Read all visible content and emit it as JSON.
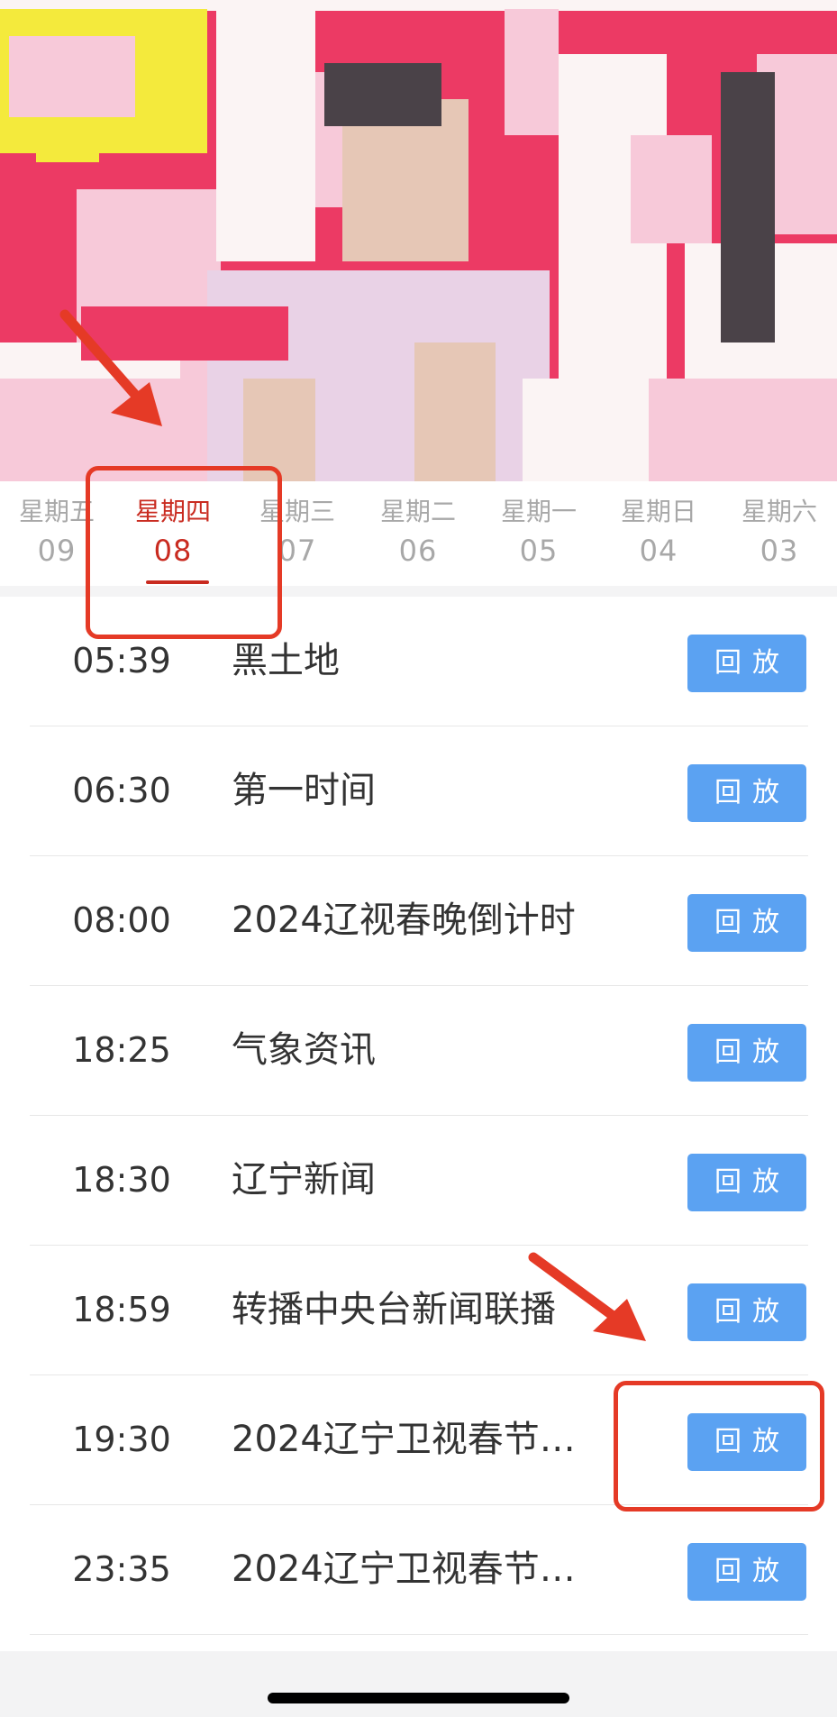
{
  "poster": {
    "colors": {
      "background": "#ec3a64",
      "pink_light": "#f7c9d9",
      "white": "#fbf4f4",
      "yellow": "#f4ea3c",
      "skin": "#e6c7b6",
      "dress": "#e9d2e6",
      "dark_hair": "#4a4248"
    }
  },
  "day_tabs": [
    {
      "weekday": "星期五",
      "day": "09"
    },
    {
      "weekday": "星期四",
      "day": "08"
    },
    {
      "weekday": "星期三",
      "day": "07"
    },
    {
      "weekday": "星期二",
      "day": "06"
    },
    {
      "weekday": "星期一",
      "day": "05"
    },
    {
      "weekday": "星期日",
      "day": "04"
    },
    {
      "weekday": "星期六",
      "day": "03"
    }
  ],
  "selected_tab": "星期四",
  "programs": [
    {
      "time": "05:39",
      "title": "黑土地",
      "button": "回放"
    },
    {
      "time": "06:30",
      "title": "第一时间",
      "button": "回放"
    },
    {
      "time": "08:00",
      "title": "2024辽视春晚倒计时",
      "button": "回放"
    },
    {
      "time": "18:25",
      "title": "气象资讯",
      "button": "回放"
    },
    {
      "time": "18:30",
      "title": "辽宁新闻",
      "button": "回放"
    },
    {
      "time": "18:59",
      "title": "转播中央台新闻联播",
      "button": "回放"
    },
    {
      "time": "19:30",
      "title": "2024辽宁卫视春节…",
      "button": "回放"
    },
    {
      "time": "23:35",
      "title": "2024辽宁卫视春节…",
      "button": "回放"
    }
  ],
  "colors": {
    "accent_red": "#c92b20",
    "replay_blue": "#5ba2f2",
    "annotation_red": "#e53a26",
    "inactive_tab": "#a8a8a8"
  }
}
